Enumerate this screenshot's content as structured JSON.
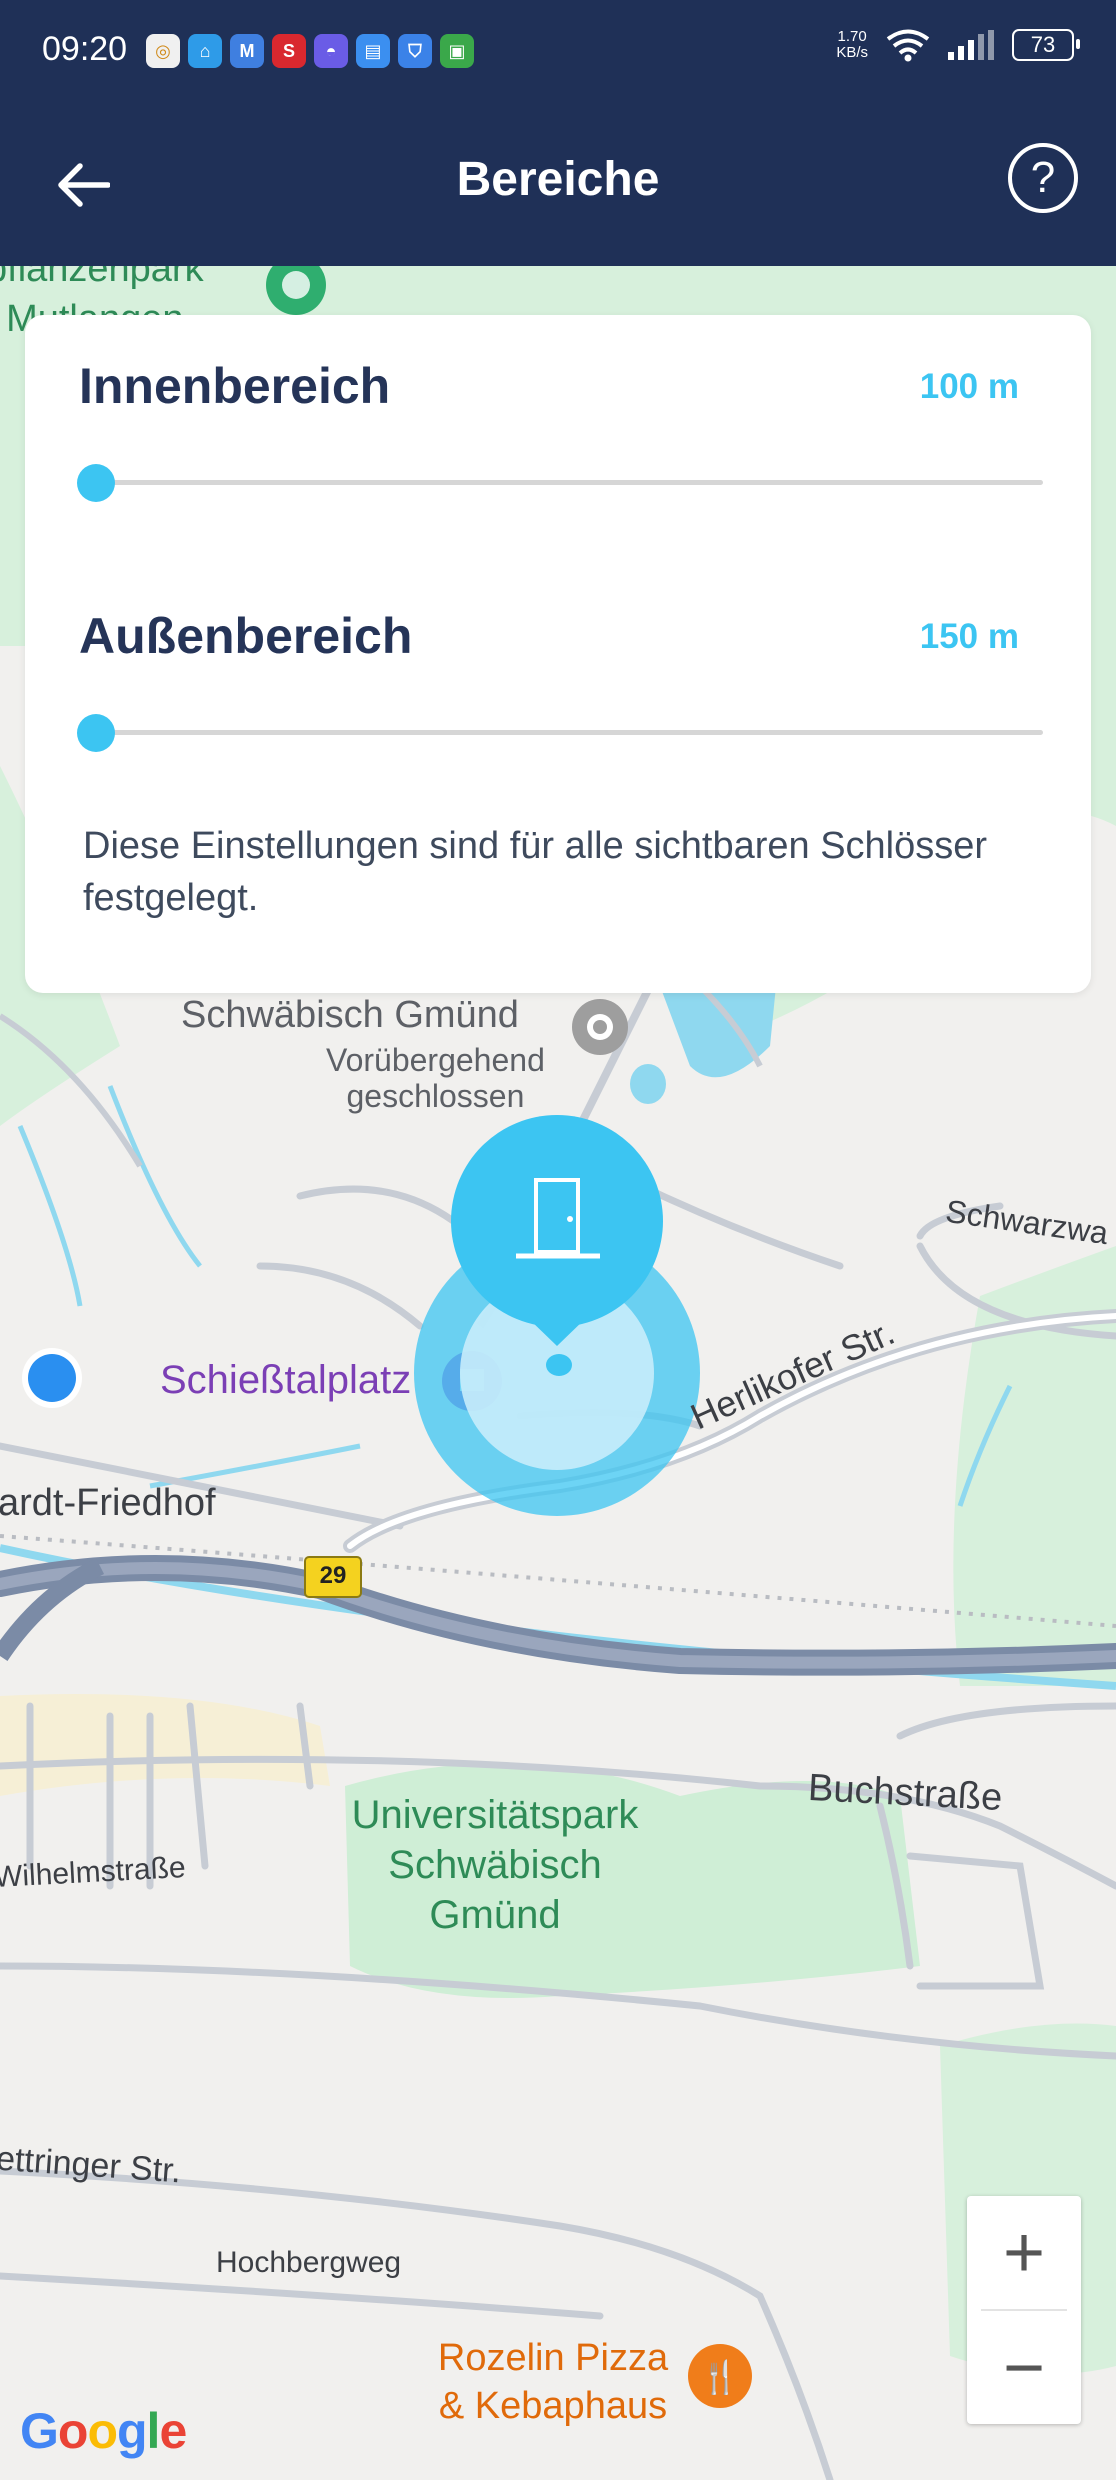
{
  "status_bar": {
    "time": "09:20",
    "net_speed_value": "1.70",
    "net_speed_unit": "KB/s",
    "battery": "73",
    "app_icons": [
      "globe-icon",
      "home-icon",
      "mail-icon",
      "s-icon",
      "planet-icon",
      "clipboard-icon",
      "shield-icon",
      "lock-icon"
    ]
  },
  "header": {
    "title": "Bereiche"
  },
  "settings": {
    "inner": {
      "label": "Innenbereich",
      "value": "100 m",
      "level": 0
    },
    "outer": {
      "label": "Außenbereich",
      "value": "150 m",
      "level": 0
    },
    "note": "Diese Einstellungen sind für alle sichtbaren Schlösser festgelegt."
  },
  "map": {
    "labels": {
      "park_top": "pflanzenpark\nMutlangen",
      "place_1": "Schwäbisch Gmünd",
      "place_1_status": "Vorübergehend\ngeschlossen",
      "schwarzwa": "Schwarzwa",
      "schiesstalplatz": "Schießtalplatz",
      "herlikofer": "Herlikofer Str.",
      "friedhof": "ardt-Friedhof",
      "route": "29",
      "buchstrasse": "Buchstraße",
      "universitaetspark": "Universitätspark\nSchwäbisch\nGmünd",
      "wilhelmstrasse": "Wilhelmstraße",
      "oettinger": "ettringer Str.",
      "hochbergweg": "Hochbergweg",
      "restaurant": "Rozelin Pizza\n& Kebaphaus",
      "google": "Google"
    },
    "colors": {
      "accent": "#3cc5f2",
      "navy": "#1f3057",
      "road": "#c7ccd4",
      "highway": "#7b8ba6",
      "green": "#d7f0dc",
      "water": "#8fd8ef"
    }
  },
  "zoom": {
    "in": "+",
    "out": "−"
  }
}
